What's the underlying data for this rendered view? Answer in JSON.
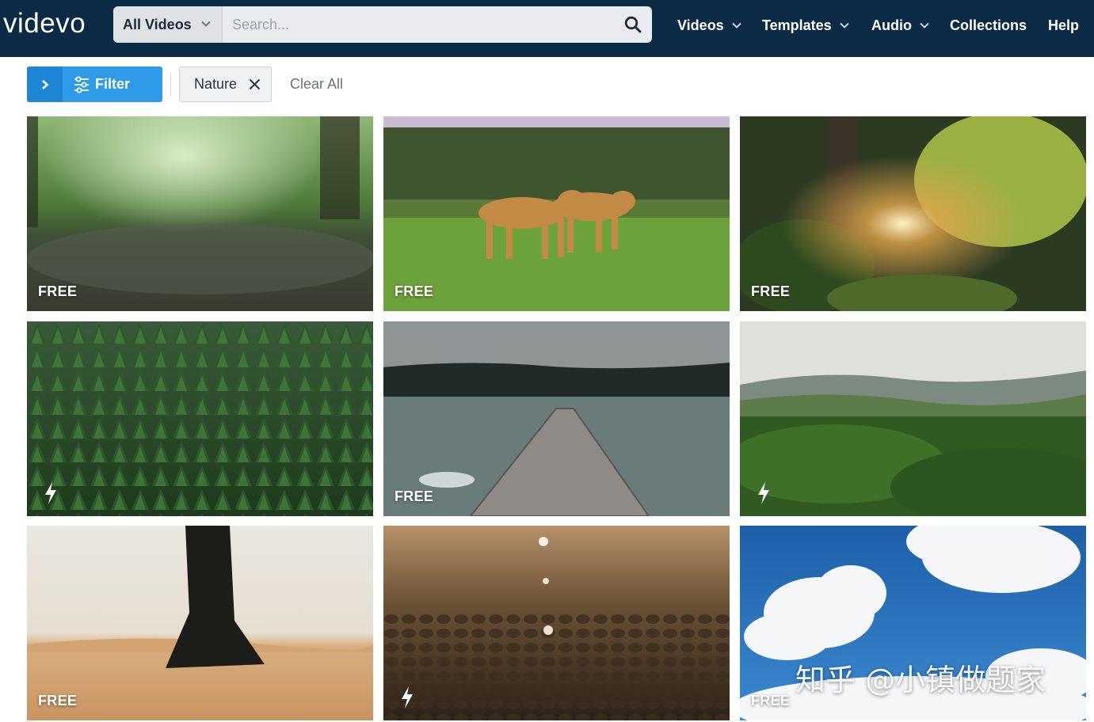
{
  "header": {
    "logo": "videvo",
    "category_select": "All Videos",
    "search_placeholder": "Search...",
    "nav": [
      {
        "label": "Videos",
        "dropdown": true
      },
      {
        "label": "Templates",
        "dropdown": true
      },
      {
        "label": "Audio",
        "dropdown": true
      },
      {
        "label": "Collections",
        "dropdown": false
      },
      {
        "label": "Help",
        "dropdown": false
      }
    ]
  },
  "filters": {
    "filter_label": "Filter",
    "filter_count": "1",
    "active_tag": "Nature",
    "clear_all": "Clear All"
  },
  "videos": [
    {
      "scene": "rain-on-forest-ground",
      "badge": "FREE"
    },
    {
      "scene": "lionesses-walking",
      "badge": "FREE"
    },
    {
      "scene": "sunlight-through-leaves",
      "badge": "FREE"
    },
    {
      "scene": "aerial-pine-forest",
      "badge": "premium-bolt-icon"
    },
    {
      "scene": "pier-on-lake",
      "badge": "FREE"
    },
    {
      "scene": "aerial-green-hills",
      "badge": "premium-bolt-icon"
    },
    {
      "scene": "woman-walking-on-desert-sand",
      "badge": "FREE"
    },
    {
      "scene": "water-drops-on-soil",
      "badge": "premium-bolt-icon"
    },
    {
      "scene": "clouds-in-blue-sky",
      "badge": "FREE"
    }
  ],
  "watermark": "知乎 @小镇做题家",
  "colors": {
    "header_bg": "#0b2a45",
    "filter_button": "#2f9be8",
    "chip_bg": "#f0f1f3"
  }
}
